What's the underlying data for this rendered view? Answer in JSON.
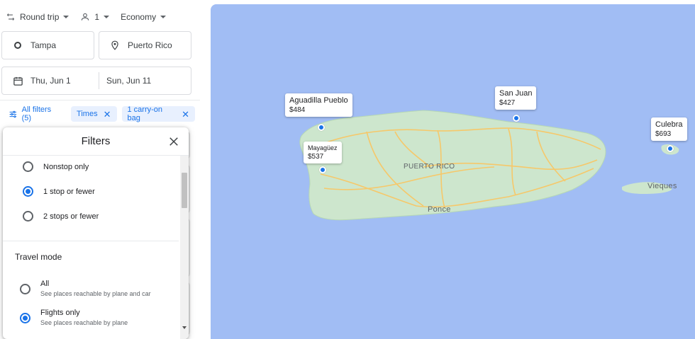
{
  "trip": {
    "trip_type": "Round trip",
    "passengers": "1",
    "cabin_class": "Economy"
  },
  "search": {
    "origin": "Tampa",
    "destination": "Puerto Rico",
    "depart_date": "Thu, Jun 1",
    "return_date": "Sun, Jun 11"
  },
  "filters_bar": {
    "all_filters_label": "All filters (5)",
    "chips": [
      "Times",
      "1 carry-on bag"
    ]
  },
  "filters_panel": {
    "title": "Filters",
    "stops_options": [
      {
        "label": "Nonstop only",
        "selected": false
      },
      {
        "label": "1 stop or fewer",
        "selected": true
      },
      {
        "label": "2 stops or fewer",
        "selected": false
      }
    ],
    "travel_mode_title": "Travel mode",
    "travel_mode_options": [
      {
        "label": "All",
        "description": "See places reachable by plane and car",
        "selected": false
      },
      {
        "label": "Flights only",
        "description": "See places reachable by plane",
        "selected": true
      }
    ]
  },
  "map": {
    "destinations": [
      {
        "name": "Aguadilla Pueblo",
        "price": "$484"
      },
      {
        "name": "San Juan",
        "price": "$427"
      },
      {
        "name": "Mayagüez",
        "price": "$537"
      },
      {
        "name": "Culebra",
        "price": "$693"
      }
    ],
    "labels": {
      "island": "PUERTO RICO",
      "ponce": "Ponce",
      "vieques": "Vieques"
    },
    "colors": {
      "water": "#a1bdf4",
      "land": "#cfe8cf",
      "roads": "#f6c86a",
      "pin_dot": "#1a73e8"
    }
  },
  "icons": [
    "swap-icon",
    "person-icon",
    "circle-icon",
    "location-pin-icon",
    "calendar-icon",
    "filter-icon",
    "close-icon"
  ]
}
